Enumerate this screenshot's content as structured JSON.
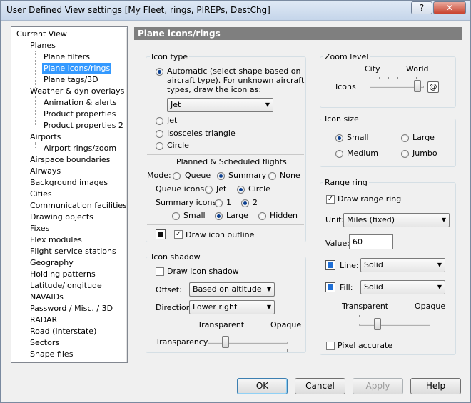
{
  "window": {
    "title": "User Defined View settings  [My Fleet, rings, PIREPs, DestChg]"
  },
  "tree": {
    "items": [
      {
        "label": "Current View"
      },
      {
        "label": "Planes"
      },
      {
        "label": "Plane filters"
      },
      {
        "label": "Plane icons/rings",
        "selected": true
      },
      {
        "label": "Plane tags/3D"
      },
      {
        "label": "Weather & dyn overlays"
      },
      {
        "label": "Animation & alerts"
      },
      {
        "label": "Product properties"
      },
      {
        "label": "Product properties 2"
      },
      {
        "label": "Airports"
      },
      {
        "label": "Airport rings/zoom"
      },
      {
        "label": "Airspace boundaries"
      },
      {
        "label": "Airways"
      },
      {
        "label": "Background images"
      },
      {
        "label": "Cities"
      },
      {
        "label": "Communication facilities"
      },
      {
        "label": "Drawing objects"
      },
      {
        "label": "Fixes"
      },
      {
        "label": "Flex modules"
      },
      {
        "label": "Flight service stations"
      },
      {
        "label": "Geography"
      },
      {
        "label": "Holding patterns"
      },
      {
        "label": "Latitude/longitude"
      },
      {
        "label": "NAVAIDs"
      },
      {
        "label": "Password / Misc. / 3D"
      },
      {
        "label": "RADAR"
      },
      {
        "label": "Road (Interstate)"
      },
      {
        "label": "Sectors"
      },
      {
        "label": "Shape files"
      }
    ]
  },
  "panel": {
    "title": "Plane icons/rings"
  },
  "icon_type": {
    "title": "Icon type",
    "automatic_line1": "Automatic (select shape based on",
    "automatic_line2": "aircraft type).  For unknown aircraft",
    "automatic_line3": "types, draw the icon as:",
    "unknown_select": "Jet",
    "jet": "Jet",
    "isosceles": "Isosceles triangle",
    "circle": "Circle"
  },
  "planned": {
    "title": "Planned & Scheduled flights",
    "mode_label": "Mode:",
    "mode_queue": "Queue",
    "mode_summary": "Summary",
    "mode_none": "None",
    "queue_icons_label": "Queue icons:",
    "qi_jet": "Jet",
    "qi_circle": "Circle",
    "summary_icons_label": "Summary icons:",
    "si_1": "1",
    "si_2": "2",
    "si_small": "Small",
    "si_large": "Large",
    "si_hidden": "Hidden",
    "draw_outline": "Draw icon outline"
  },
  "icon_shadow": {
    "title": "Icon shadow",
    "draw_shadow": "Draw icon shadow",
    "offset_label": "Offset:",
    "offset_value": "Based on altitude",
    "direction_label": "Direction:",
    "direction_value": "Lower right",
    "transparent": "Transparent",
    "opaque": "Opaque",
    "transparency_label": "Transparency"
  },
  "zoom_level": {
    "title": "Zoom level",
    "city": "City",
    "world": "World",
    "icons_label": "Icons",
    "icon_button": "@"
  },
  "icon_size": {
    "title": "Icon size",
    "small": "Small",
    "large": "Large",
    "medium": "Medium",
    "jumbo": "Jumbo"
  },
  "range_ring": {
    "title": "Range ring",
    "draw_ring": "Draw range ring",
    "unit_label": "Unit:",
    "unit_value": "Miles (fixed)",
    "value_label": "Value:",
    "value": "60",
    "line_label": "Line:",
    "line_value": "Solid",
    "fill_label": "Fill:",
    "fill_value": "Solid",
    "transparent": "Transparent",
    "opaque": "Opaque",
    "pixel_accurate": "Pixel accurate",
    "line_color": "#1f6fd6",
    "fill_color": "#1f6fd6"
  },
  "buttons": {
    "ok": "OK",
    "cancel": "Cancel",
    "apply": "Apply",
    "help": "Help"
  },
  "titlebar": {
    "help_glyph": "?",
    "close_glyph": "✕"
  }
}
